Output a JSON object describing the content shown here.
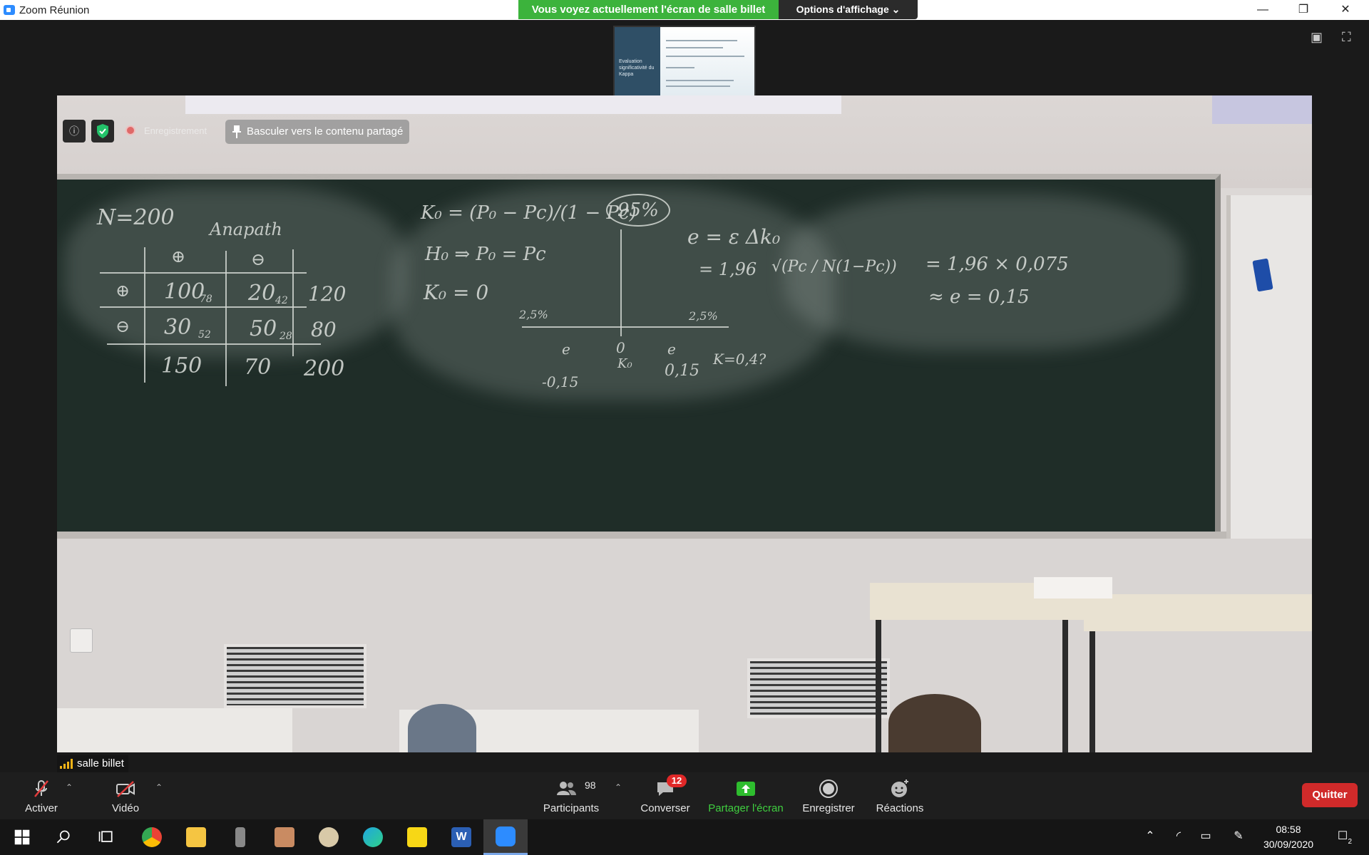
{
  "window": {
    "title": "Zoom Réunion",
    "share_banner": "Vous voyez actuellement l'écran de salle billet",
    "view_options": "Options d'affichage"
  },
  "shared_thumbnail": {
    "slide_title": "Evaluation significativité du Kappa"
  },
  "video_overlay": {
    "recording_label": "Enregistrement",
    "switch_button": "Basculer vers le contenu partagé"
  },
  "participant_name": "salle billet",
  "toolbar": {
    "mute_label": "Activer",
    "video_label": "Vidéo",
    "participants_label": "Participants",
    "participants_count": "98",
    "chat_label": "Converser",
    "chat_badge": "12",
    "share_label": "Partager l'écran",
    "record_label": "Enregistrer",
    "reactions_label": "Réactions",
    "quit_label": "Quitter"
  },
  "taskbar": {
    "time": "08:58",
    "date": "30/09/2020",
    "notification_count": "2",
    "apps": [
      "start-icon",
      "search-icon",
      "task-view-icon",
      "chrome-icon",
      "file-explorer-icon",
      "microphone-app-icon",
      "photo-app-icon",
      "paint-icon",
      "edge-icon",
      "sticky-notes-icon",
      "word-icon",
      "zoom-icon"
    ]
  },
  "chalkboard": {
    "n_label": "N=200",
    "anapath": "Anapath",
    "col_plus": "⊕",
    "col_minus": "⊖",
    "row_plus": "⊕",
    "row_minus": "⊖",
    "c11": "100",
    "c11_sub": "78",
    "c12": "20",
    "c12_sub": "42",
    "r1_total": "120",
    "c21": "30",
    "c21_sub": "52",
    "c22": "50",
    "c22_sub": "28",
    "r2_total": "80",
    "col1_total": "150",
    "col2_total": "70",
    "grand_total": "200",
    "k0_formula": "K₀ = (P₀ − Pc)/(1 − Pc)",
    "h0": "H₀ ⇒ P₀ = Pc",
    "k0_zero": "K₀ = 0",
    "pct95": "95%",
    "pct25_left": "2,5%",
    "pct25_right": "2,5%",
    "axis_e_left": "e",
    "axis_zero": "0",
    "axis_k0": "K₀",
    "axis_e_right": "e",
    "neg015": "-0,15",
    "pos015": "0,15",
    "k_value": "K=0,4?",
    "e_formula": "e = ε Δk₀",
    "e_196": "= 1,96",
    "sqrt": "√(Pc / N(1−Pc))",
    "calc1": "= 1,96 × 0,075",
    "calc2": "≈ e = 0,15"
  }
}
